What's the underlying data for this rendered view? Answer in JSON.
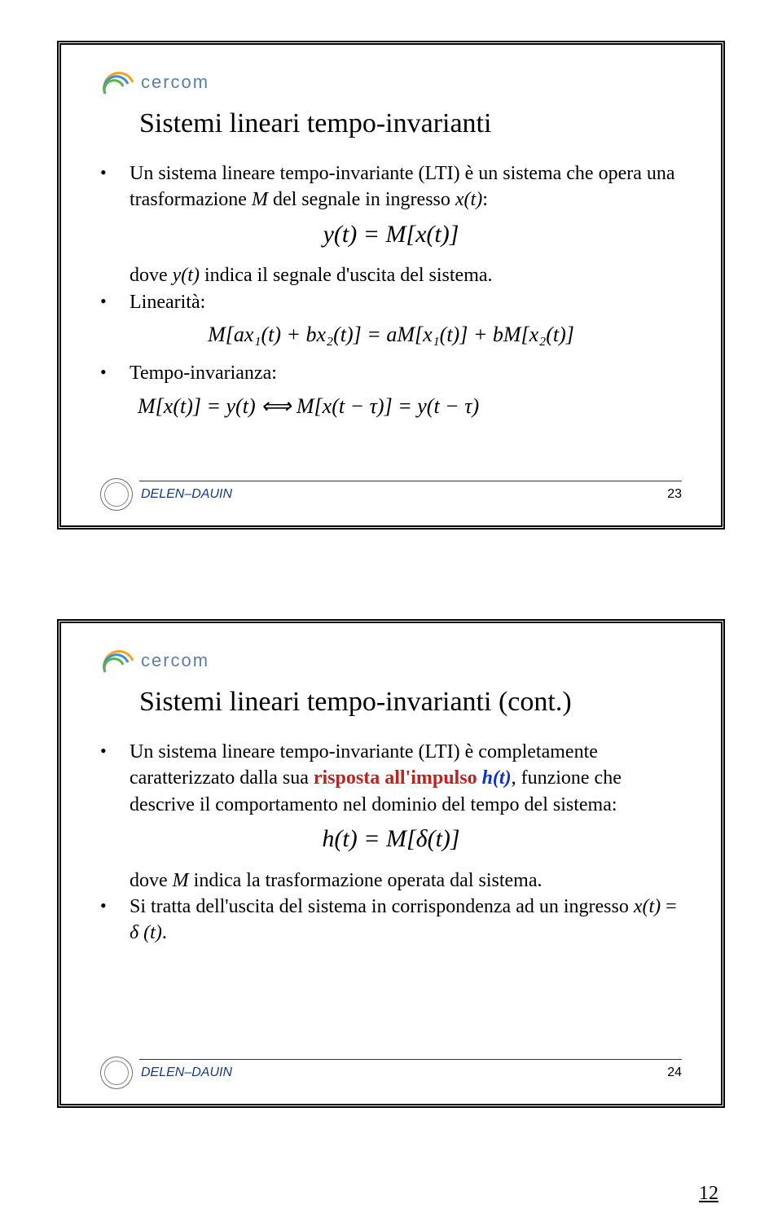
{
  "logo_text": "cercom",
  "footer_label": "DELEN–DAUIN",
  "page_number": "12",
  "slide1": {
    "number": "23",
    "title": "Sistemi lineari tempo-invarianti",
    "b1_pre": "Un sistema lineare tempo-invariante (LTI) è un sistema che opera una trasformazione ",
    "b1_M": "M",
    "b1_mid": " del segnale in ingresso ",
    "b1_xt": "x(t)",
    "b1_colon": ":",
    "eq1": "y(t) = M[x(t)]",
    "b2_pre": "dove ",
    "b2_yt": "y(t)",
    "b2_post": " indica il segnale d'uscita del sistema.",
    "b3": "Linearità:",
    "eq2": "M[ax₁(t) + bx₂(t)] = aM[x₁(t)] + bM[x₂(t)]",
    "b4": "Tempo-invarianza:",
    "eq3": "M[x(t)] = y(t)  ⟺  M[x(t − τ)] = y(t − τ)"
  },
  "slide2": {
    "number": "24",
    "title": "Sistemi lineari tempo-invarianti (cont.)",
    "b1_pre": "Un sistema lineare tempo-invariante (LTI) è completamente caratterizzato dalla sua ",
    "b1_risposta": "risposta all'impulso",
    "b1_sp": " ",
    "b1_ht": "h(t)",
    "b1_post": ", funzione che descrive il comportamento nel dominio del tempo del sistema:",
    "eq1": "h(t) = M[δ(t)]",
    "b2_pre": "dove ",
    "b2_M": "M",
    "b2_post": " indica la trasformazione operata dal sistema.",
    "b3_pre": "Si tratta dell'uscita del sistema in corrispondenza ad un ingresso ",
    "b3_xt": "x(t)",
    "b3_eq": " = ",
    "b3_de": "δ ",
    "b3_t": "(t)",
    "b3_dot": "."
  }
}
